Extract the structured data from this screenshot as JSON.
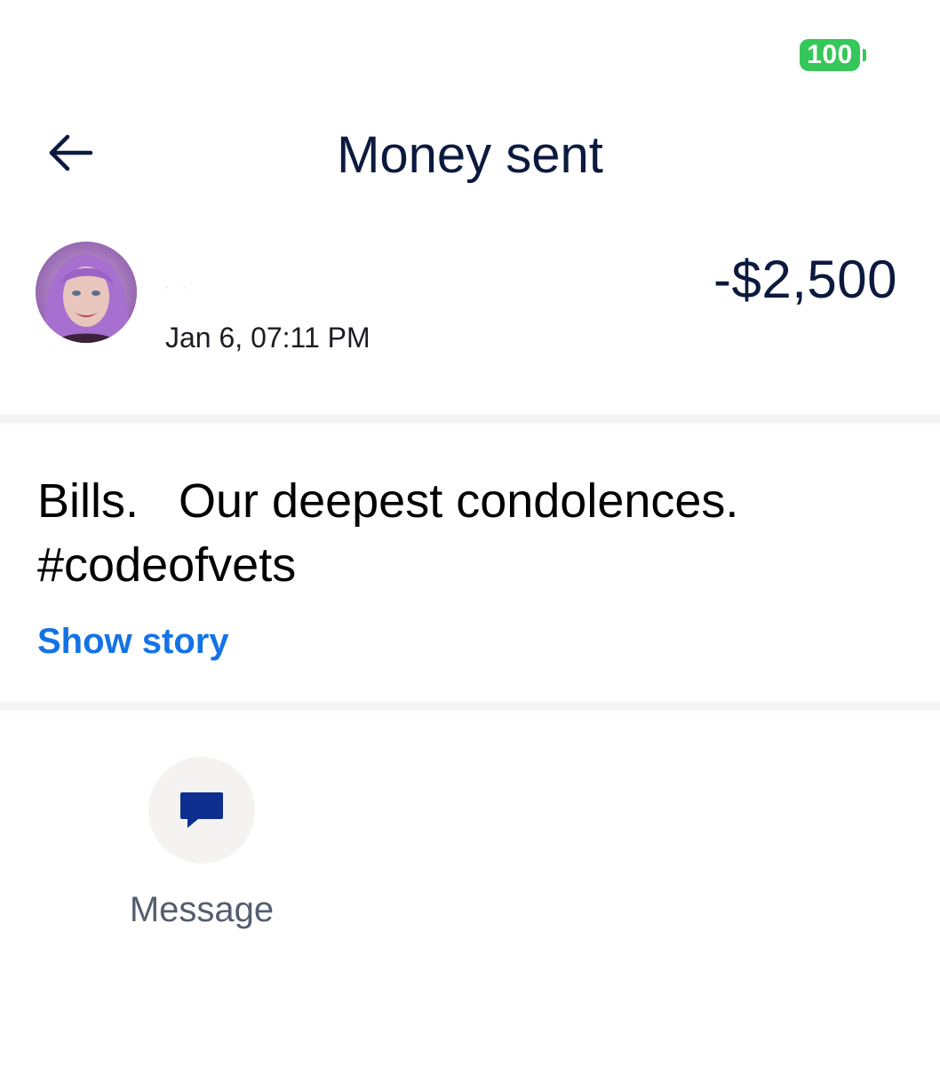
{
  "status_bar": {
    "battery_level": "100",
    "battery_color": "#35c759"
  },
  "header": {
    "back_icon": "arrow-left-icon",
    "title": "Money sent"
  },
  "transaction": {
    "avatar": "profile-photo",
    "recipient_name": "· ·",
    "date": "Jan 6, 07:11 PM",
    "amount": "-$2,500"
  },
  "note": {
    "text": "Bills.   Our deepest condolences.\n#codeofvets",
    "show_story_label": "Show story",
    "link_color": "#1373e6"
  },
  "actions": {
    "message": {
      "icon": "chat-bubble-icon",
      "label": "Message"
    }
  }
}
